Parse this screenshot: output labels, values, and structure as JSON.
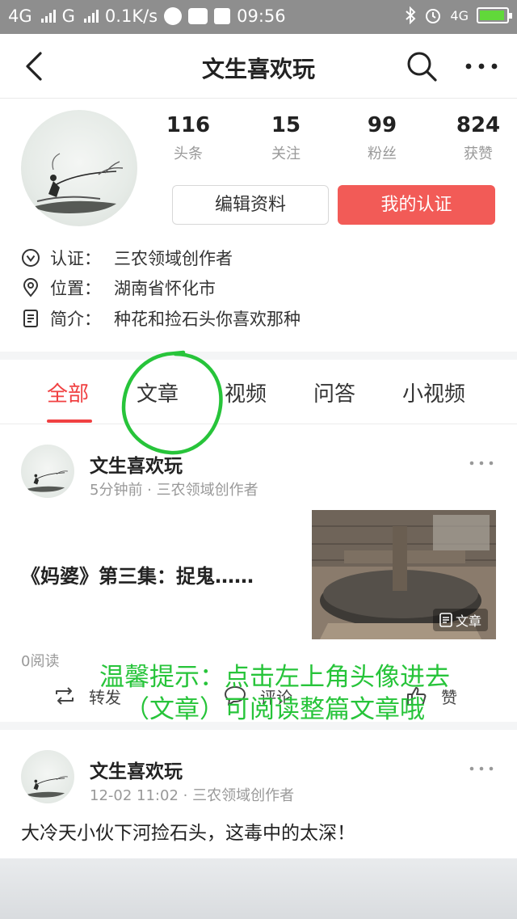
{
  "status_bar": {
    "network1": "4G",
    "network2": "G",
    "speed": "0.1K/s",
    "time": "09:56",
    "network3": "4G"
  },
  "nav": {
    "title": "文生喜欢玩"
  },
  "profile": {
    "stats": [
      {
        "value": "116",
        "label": "头条"
      },
      {
        "value": "15",
        "label": "关注"
      },
      {
        "value": "99",
        "label": "粉丝"
      },
      {
        "value": "824",
        "label": "获赞"
      }
    ],
    "edit_button": "编辑资料",
    "verify_button": "我的认证",
    "info": [
      {
        "key": "认证：",
        "value": "三农领域创作者",
        "icon": "verified-icon"
      },
      {
        "key": "位置：",
        "value": "湖南省怀化市",
        "icon": "location-pin-icon"
      },
      {
        "key": "简介：",
        "value": "种花和捡石头你喜欢那种",
        "icon": "document-icon"
      }
    ]
  },
  "tabs": [
    {
      "label": "全部",
      "active": true
    },
    {
      "label": "文章",
      "active": false
    },
    {
      "label": "视频",
      "active": false
    },
    {
      "label": "问答",
      "active": false
    },
    {
      "label": "小视频",
      "active": false
    }
  ],
  "posts": [
    {
      "author": "文生喜欢玩",
      "meta": "5分钟前 · 三农领域创作者",
      "title": "《妈婆》第三集：捉鬼……",
      "thumb_badge": "文章",
      "reads": "0阅读",
      "actions": {
        "share": "转发",
        "comment": "评论",
        "like": "赞"
      }
    },
    {
      "author": "文生喜欢玩",
      "meta": "12-02 11:02 · 三农领域创作者",
      "text": "大冷天小伙下河捡石头，这毒中的太深！"
    }
  ],
  "annotation": {
    "tip": "温馨提示：点击左上角头像进去（文章）可阅读整篇文章哦"
  },
  "colors": {
    "accent_red": "#f04142",
    "verify_button_bg": "#f25b57",
    "annotation_green": "#27c43a",
    "status_bar_bg": "#8e8e8e"
  }
}
